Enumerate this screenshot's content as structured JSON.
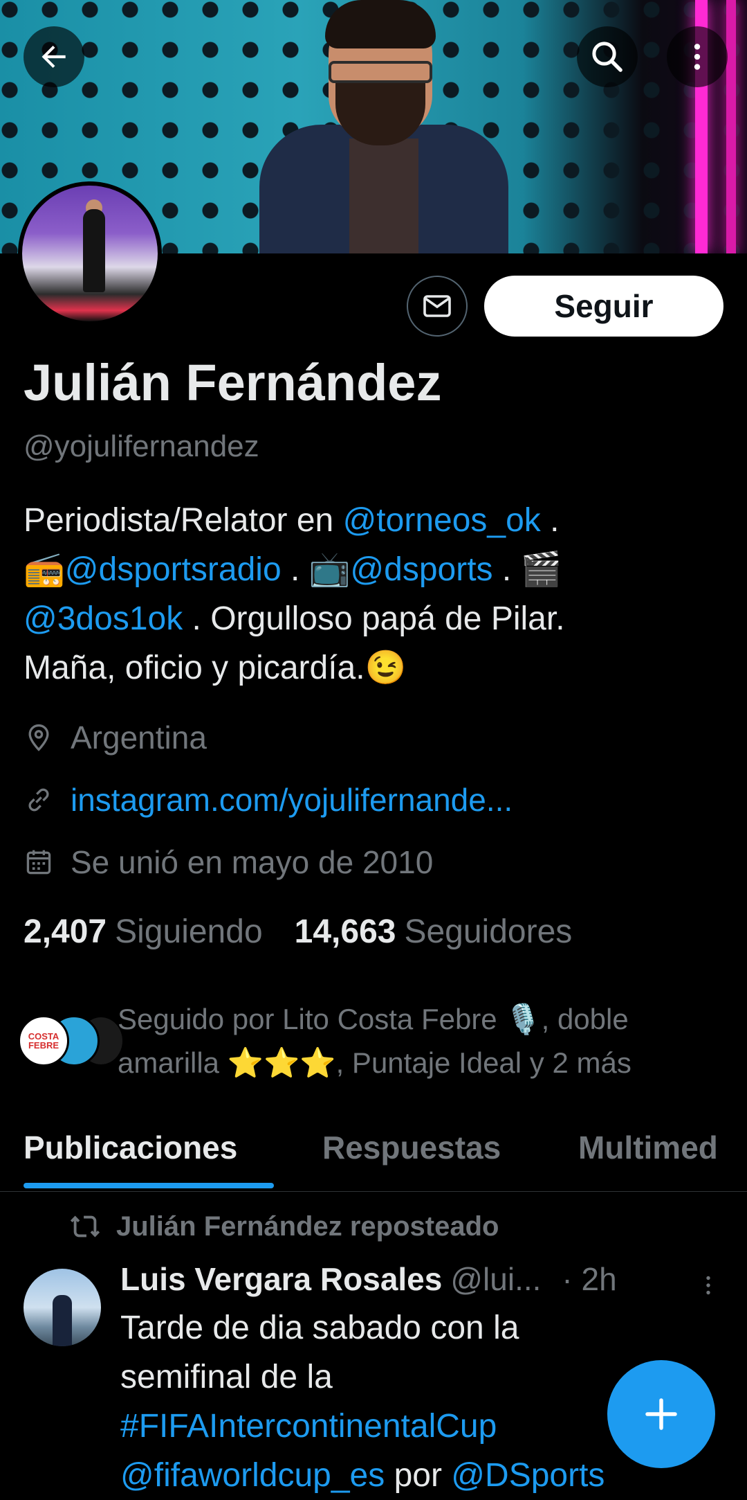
{
  "profile": {
    "name": "Julián Fernández",
    "handle": "@yojulifernandez",
    "follow_label": "Seguir"
  },
  "bio": {
    "line1_text": "Periodista/Relator en ",
    "line1_mention": "@torneos_ok",
    "line1_end": " .",
    "line2_emoji1": "📻",
    "line2_mention1": "@dsportsradio",
    "line2_sep1": " . ",
    "line2_emoji2": "📺",
    "line2_mention2": "@dsports",
    "line2_sep2": " . ",
    "line2_emoji3": "🎬",
    "line3_mention": "@3dos1ok",
    "line3_text": " . Orgulloso papá de Pilar.",
    "line4_text": "Maña, oficio y picardía.",
    "line4_emoji": "😉"
  },
  "meta": {
    "location": "Argentina",
    "website": "instagram.com/yojulifernande...",
    "joined": "Se unió en mayo de 2010"
  },
  "stats": {
    "following_count": "2,407",
    "following_label": "Siguiendo",
    "followers_count": "14,663",
    "followers_label": "Seguidores"
  },
  "followed_by": {
    "avatar1_text": "COSTA FEBRE",
    "line1": "Seguido por Lito Costa Febre 🎙️, doble",
    "line2": "amarilla ⭐⭐⭐, Puntaje Ideal y 2 más"
  },
  "tabs": [
    {
      "label": "Publicaciones",
      "active": true
    },
    {
      "label": "Respuestas",
      "active": false
    },
    {
      "label": "Multimed",
      "active": false
    }
  ],
  "post": {
    "repost_label": "Julián Fernández reposteado",
    "author_name": "Luis Vergara Rosales",
    "author_handle": "@lui...",
    "time": "· 2h",
    "line1": "Tarde de dia sabado con la",
    "line2": "semifinal de la",
    "hashtag": "#FIFAIntercontinentalCup",
    "mention1": "@fifaworldcup_es",
    "por": " por ",
    "mention2": "@DSports"
  },
  "colors": {
    "accent": "#1d9bf0",
    "background": "#000000",
    "text_primary": "#e7e9ea",
    "text_secondary": "#71767b"
  }
}
